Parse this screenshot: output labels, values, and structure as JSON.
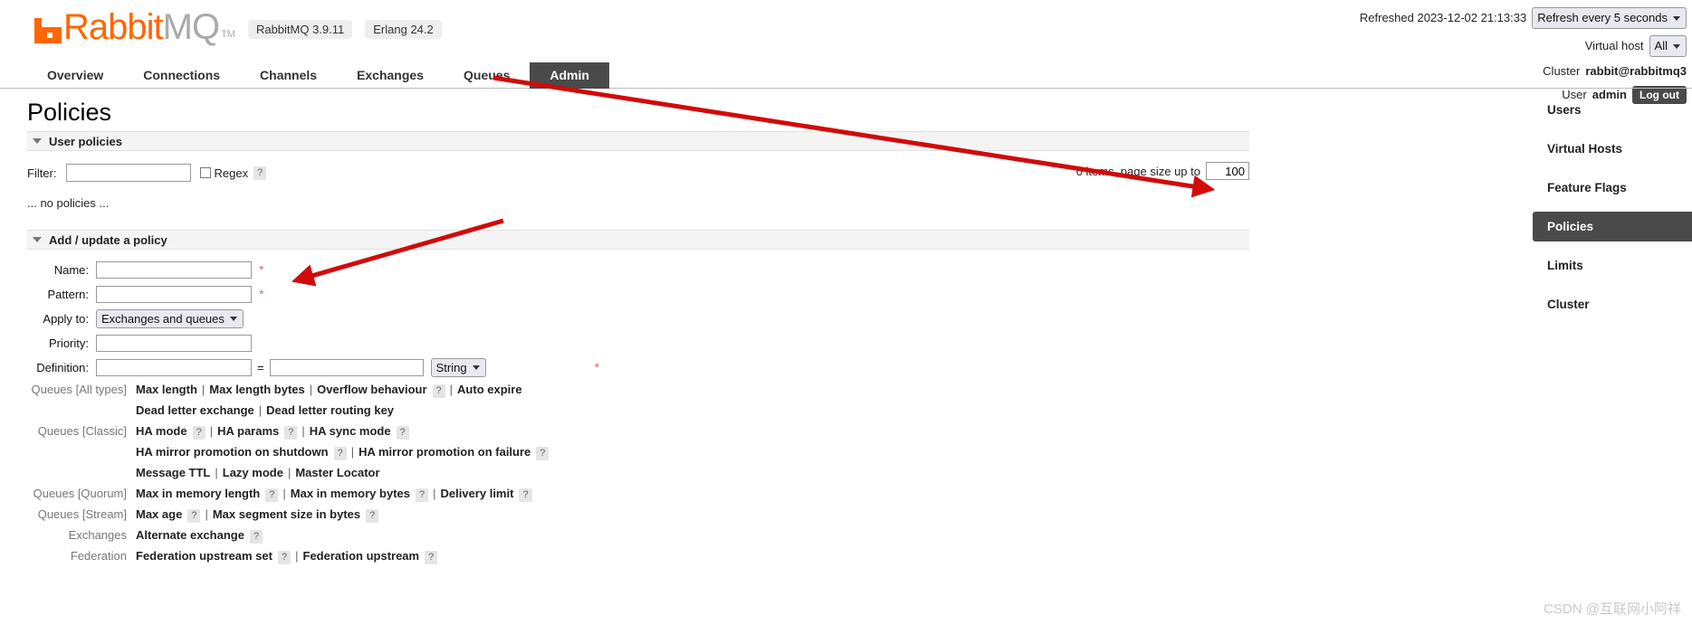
{
  "header": {
    "logo_rabbit": "Rabbit",
    "logo_mq": "MQ",
    "logo_tm": "TM",
    "version_pill": "RabbitMQ 3.9.11",
    "erlang_pill": "Erlang 24.2",
    "refreshed_text": "Refreshed 2023-12-02 21:13:33",
    "refresh_select": "Refresh every 5 seconds",
    "vhost_label": "Virtual host",
    "vhost_select": "All",
    "cluster_label": "Cluster",
    "cluster_value": "rabbit@rabbitmq3",
    "user_label": "User",
    "user_value": "admin",
    "logout_label": "Log out"
  },
  "nav": {
    "tabs": [
      {
        "label": "Overview",
        "active": false
      },
      {
        "label": "Connections",
        "active": false
      },
      {
        "label": "Channels",
        "active": false
      },
      {
        "label": "Exchanges",
        "active": false
      },
      {
        "label": "Queues",
        "active": false
      },
      {
        "label": "Admin",
        "active": true
      }
    ]
  },
  "main": {
    "page_title": "Policies",
    "user_policies_section": "User policies",
    "filter_label": "Filter:",
    "filter_value": "",
    "regex_label": "Regex",
    "regex_help": "?",
    "page_size_text": "0 items, page size up to",
    "page_size_value": "100",
    "no_policies_text": "... no policies ...",
    "add_policy_section": "Add / update a policy",
    "form": {
      "name_label": "Name:",
      "name_value": "",
      "pattern_label": "Pattern:",
      "pattern_value": "",
      "apply_to_label": "Apply to:",
      "apply_to_value": "Exchanges and queues",
      "priority_label": "Priority:",
      "priority_value": "",
      "definition_label": "Definition:",
      "definition_key": "",
      "definition_equals": "=",
      "definition_value": "",
      "definition_type": "String",
      "required_mark": "*"
    },
    "definition_links": [
      {
        "category": "Queues [All types]",
        "lines": [
          [
            {
              "label": "Max length",
              "help": false
            },
            {
              "label": "Max length bytes",
              "help": false
            },
            {
              "label": "Overflow behaviour",
              "help": true
            },
            {
              "label": "Auto expire",
              "help": false
            }
          ],
          [
            {
              "label": "Dead letter exchange",
              "help": false
            },
            {
              "label": "Dead letter routing key",
              "help": false
            }
          ]
        ]
      },
      {
        "category": "Queues [Classic]",
        "lines": [
          [
            {
              "label": "HA mode",
              "help": true
            },
            {
              "label": "HA params",
              "help": true
            },
            {
              "label": "HA sync mode",
              "help": true
            }
          ],
          [
            {
              "label": "HA mirror promotion on shutdown",
              "help": true
            },
            {
              "label": "HA mirror promotion on failure",
              "help": true
            }
          ],
          [
            {
              "label": "Message TTL",
              "help": false
            },
            {
              "label": "Lazy mode",
              "help": false
            },
            {
              "label": "Master Locator",
              "help": false
            }
          ]
        ]
      },
      {
        "category": "Queues [Quorum]",
        "lines": [
          [
            {
              "label": "Max in memory length",
              "help": true
            },
            {
              "label": "Max in memory bytes",
              "help": true
            },
            {
              "label": "Delivery limit",
              "help": true
            }
          ]
        ]
      },
      {
        "category": "Queues [Stream]",
        "lines": [
          [
            {
              "label": "Max age",
              "help": true
            },
            {
              "label": "Max segment size in bytes",
              "help": true
            }
          ]
        ]
      },
      {
        "category": "Exchanges",
        "lines": [
          [
            {
              "label": "Alternate exchange",
              "help": true
            }
          ]
        ]
      },
      {
        "category": "Federation",
        "lines": [
          [
            {
              "label": "Federation upstream set",
              "help": true
            },
            {
              "label": "Federation upstream",
              "help": true
            }
          ]
        ]
      }
    ]
  },
  "sidebar": {
    "items": [
      {
        "label": "Users",
        "active": false
      },
      {
        "label": "Virtual Hosts",
        "active": false
      },
      {
        "label": "Feature Flags",
        "active": false
      },
      {
        "label": "Policies",
        "active": true
      },
      {
        "label": "Limits",
        "active": false
      },
      {
        "label": "Cluster",
        "active": false
      }
    ]
  },
  "watermark": "CSDN @互联网小阿祥",
  "colors": {
    "brand_orange": "#f60",
    "active_tab": "#4a4a4a",
    "annotation_red": "#d10a0a",
    "required_red": "#d96a6a"
  }
}
